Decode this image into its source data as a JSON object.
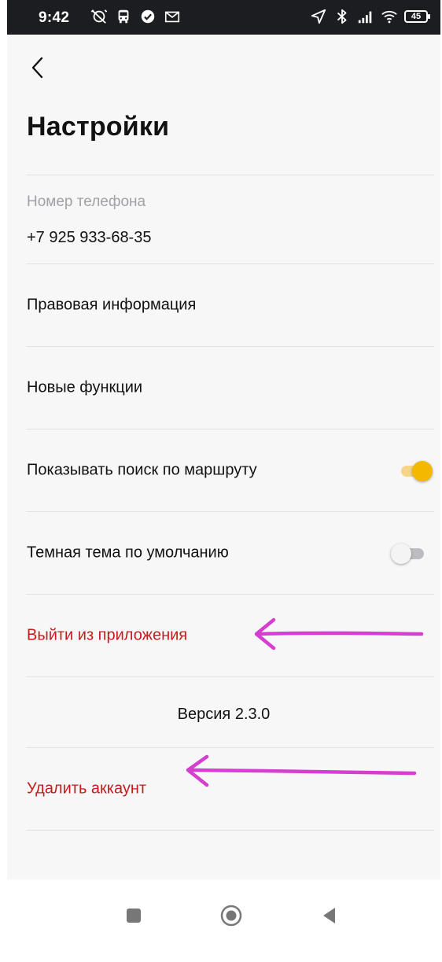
{
  "status_bar": {
    "time": "9:42",
    "battery": "45",
    "icons_left": [
      "alarm-off-icon",
      "bus-icon",
      "check-circle-icon",
      "gmail-icon"
    ],
    "icons_right": [
      "location-icon",
      "bluetooth-icon",
      "signal-icon",
      "wifi-icon",
      "battery-icon"
    ]
  },
  "header": {
    "back_icon": "chevron-left-icon",
    "title": "Настройки"
  },
  "phone": {
    "label": "Номер телефона",
    "value": "+7 925 933-68-35"
  },
  "rows": {
    "legal": "Правовая информация",
    "new_features": "Новые функции",
    "route_search": "Показывать поиск по маршруту",
    "dark_theme": "Темная тема по умолчанию",
    "logout": "Выйти из приложения",
    "delete_account": "Удалить аккаунт"
  },
  "toggles": {
    "route_search_on": true,
    "dark_theme_on": false
  },
  "version": "Версия 2.3.0",
  "colors": {
    "accent": "#f5b800",
    "danger": "#c31d1d",
    "annotation": "#d63ecf",
    "status_bar": "#1b1d20"
  },
  "navbar": {
    "icons": [
      "recents-square-icon",
      "home-circle-icon",
      "back-triangle-icon"
    ]
  }
}
